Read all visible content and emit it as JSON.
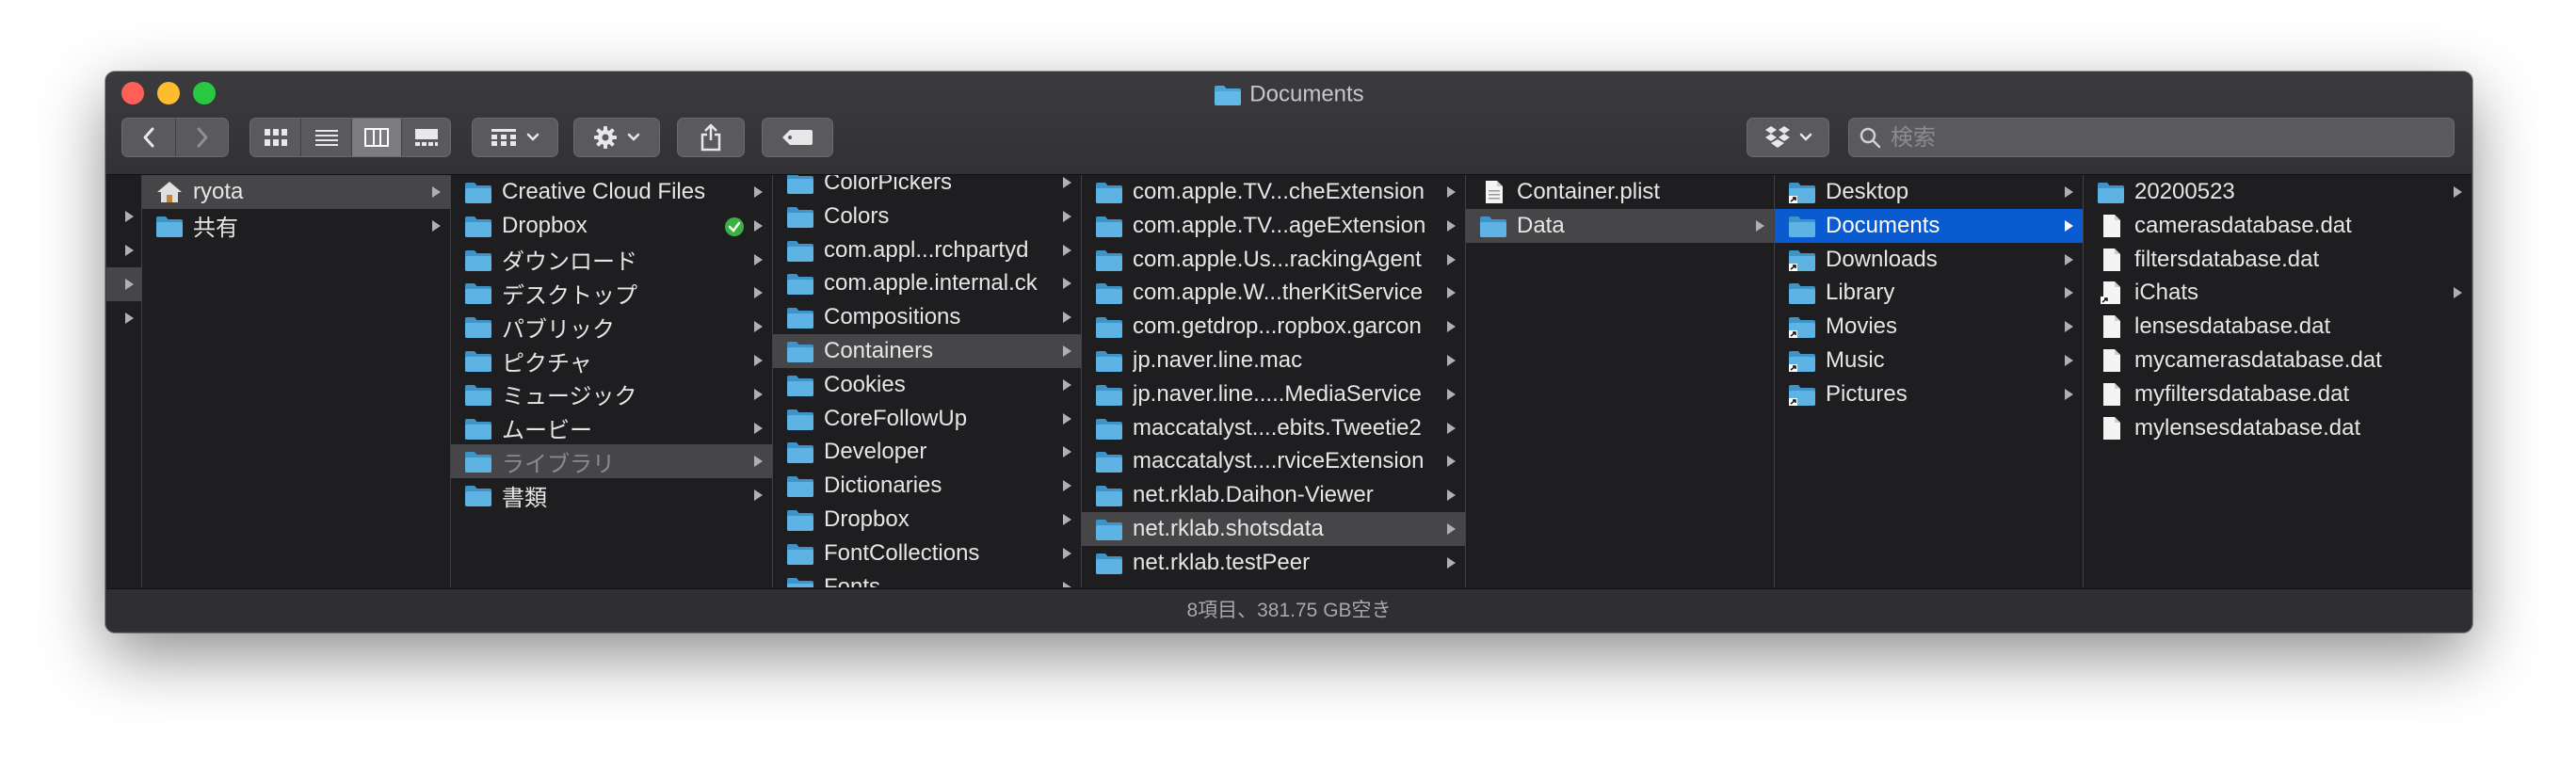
{
  "window": {
    "title": "Documents",
    "colors": {
      "close": "#ff5f57",
      "minimize": "#febc2e",
      "zoom": "#28c840",
      "selection": "#0b5bd0",
      "folder": "#4aa5d8"
    }
  },
  "toolbar": {
    "back_icon": "chevron-left-icon",
    "forward_icon": "chevron-right-icon",
    "view_modes": [
      "icon-view-icon",
      "list-view-icon",
      "column-view-icon",
      "gallery-view-icon"
    ],
    "selected_view": "column-view-icon",
    "group_icon": "group-grid-icon",
    "action_icon": "gear-icon",
    "share_icon": "share-icon",
    "tag_icon": "tag-icon",
    "dropbox_icon": "dropbox-icon"
  },
  "search": {
    "placeholder": "検索"
  },
  "columns": [
    {
      "items": [
        {
          "label": "",
          "arrow": true
        },
        {
          "label": "",
          "arrow": true
        },
        {
          "label": "",
          "arrow": true,
          "highlight": true
        },
        {
          "label": "",
          "arrow": true
        }
      ]
    },
    {
      "items": [
        {
          "label": "ryota",
          "icon": "home-icon",
          "arrow": true,
          "highlight": true
        },
        {
          "label": "共有",
          "icon": "folder-icon",
          "arrow": true
        }
      ]
    },
    {
      "items": [
        {
          "label": "Creative Cloud Files",
          "icon": "folder-icon",
          "arrow": true
        },
        {
          "label": "Dropbox",
          "icon": "folder-icon",
          "arrow": true,
          "badge": "synced-check-icon"
        },
        {
          "label": "ダウンロード",
          "icon": "folder-icon",
          "arrow": true
        },
        {
          "label": "デスクトップ",
          "icon": "folder-icon",
          "arrow": true
        },
        {
          "label": "パブリック",
          "icon": "folder-icon",
          "arrow": true
        },
        {
          "label": "ピクチャ",
          "icon": "folder-icon",
          "arrow": true
        },
        {
          "label": "ミュージック",
          "icon": "folder-icon",
          "arrow": true
        },
        {
          "label": "ムービー",
          "icon": "folder-icon",
          "arrow": true
        },
        {
          "label": "ライブラリ",
          "icon": "folder-icon",
          "arrow": true,
          "highlight": true,
          "dim": true
        },
        {
          "label": "書類",
          "icon": "folder-icon",
          "arrow": true
        }
      ]
    },
    {
      "items": [
        {
          "label": "ColorPickers",
          "icon": "folder-icon",
          "arrow": true
        },
        {
          "label": "Colors",
          "icon": "folder-icon",
          "arrow": true
        },
        {
          "label": "com.appl...rchpartyd",
          "icon": "folder-icon",
          "arrow": true
        },
        {
          "label": "com.apple.internal.ck",
          "icon": "folder-icon",
          "arrow": true
        },
        {
          "label": "Compositions",
          "icon": "folder-icon",
          "arrow": true
        },
        {
          "label": "Containers",
          "icon": "folder-icon",
          "arrow": true,
          "highlight": true
        },
        {
          "label": "Cookies",
          "icon": "folder-icon",
          "arrow": true
        },
        {
          "label": "CoreFollowUp",
          "icon": "folder-icon",
          "arrow": true
        },
        {
          "label": "Developer",
          "icon": "folder-icon",
          "arrow": true
        },
        {
          "label": "Dictionaries",
          "icon": "folder-icon",
          "arrow": true
        },
        {
          "label": "Dropbox",
          "icon": "folder-icon",
          "arrow": true
        },
        {
          "label": "FontCollections",
          "icon": "folder-icon",
          "arrow": true
        },
        {
          "label": "Fonts",
          "icon": "folder-icon",
          "arrow": true
        }
      ]
    },
    {
      "items": [
        {
          "label": "com.apple.TV...cheExtension",
          "icon": "folder-icon",
          "arrow": true
        },
        {
          "label": "com.apple.TV...ageExtension",
          "icon": "folder-icon",
          "arrow": true
        },
        {
          "label": "com.apple.Us...rackingAgent",
          "icon": "folder-icon",
          "arrow": true
        },
        {
          "label": "com.apple.W...therKitService",
          "icon": "folder-icon",
          "arrow": true
        },
        {
          "label": "com.getdrop...ropbox.garcon",
          "icon": "folder-icon",
          "arrow": true
        },
        {
          "label": "jp.naver.line.mac",
          "icon": "folder-icon",
          "arrow": true
        },
        {
          "label": "jp.naver.line.....MediaService",
          "icon": "folder-icon",
          "arrow": true
        },
        {
          "label": "maccatalyst....ebits.Tweetie2",
          "icon": "folder-icon",
          "arrow": true
        },
        {
          "label": "maccatalyst....rviceExtension",
          "icon": "folder-icon",
          "arrow": true
        },
        {
          "label": "net.rklab.Daihon-Viewer",
          "icon": "folder-icon",
          "arrow": true
        },
        {
          "label": "net.rklab.shotsdata",
          "icon": "folder-icon",
          "arrow": true,
          "highlight": true
        },
        {
          "label": "net.rklab.testPeer",
          "icon": "folder-icon",
          "arrow": true
        }
      ]
    },
    {
      "items": [
        {
          "label": "Container.plist",
          "icon": "plist-file-icon",
          "arrow": false
        },
        {
          "label": "Data",
          "icon": "folder-icon",
          "arrow": true,
          "highlight": true
        }
      ]
    },
    {
      "items": [
        {
          "label": "Desktop",
          "icon": "alias-folder-icon",
          "arrow": true
        },
        {
          "label": "Documents",
          "icon": "folder-icon",
          "arrow": true,
          "selected": true
        },
        {
          "label": "Downloads",
          "icon": "alias-folder-icon",
          "arrow": true
        },
        {
          "label": "Library",
          "icon": "folder-icon",
          "arrow": true
        },
        {
          "label": "Movies",
          "icon": "alias-folder-icon",
          "arrow": true
        },
        {
          "label": "Music",
          "icon": "alias-folder-icon",
          "arrow": true
        },
        {
          "label": "Pictures",
          "icon": "alias-folder-icon",
          "arrow": true
        }
      ]
    },
    {
      "items": [
        {
          "label": "20200523",
          "icon": "folder-icon",
          "arrow": true
        },
        {
          "label": "camerasdatabase.dat",
          "icon": "file-icon",
          "arrow": false
        },
        {
          "label": "filtersdatabase.dat",
          "icon": "file-icon",
          "arrow": false
        },
        {
          "label": "iChats",
          "icon": "alias-file-icon",
          "arrow": true
        },
        {
          "label": "lensesdatabase.dat",
          "icon": "file-icon",
          "arrow": false
        },
        {
          "label": "mycamerasdatabase.dat",
          "icon": "file-icon",
          "arrow": false
        },
        {
          "label": "myfiltersdatabase.dat",
          "icon": "file-icon",
          "arrow": false
        },
        {
          "label": "mylensesdatabase.dat",
          "icon": "file-icon",
          "arrow": false
        }
      ]
    }
  ],
  "status": {
    "text": "8項目、381.75 GB空き"
  }
}
